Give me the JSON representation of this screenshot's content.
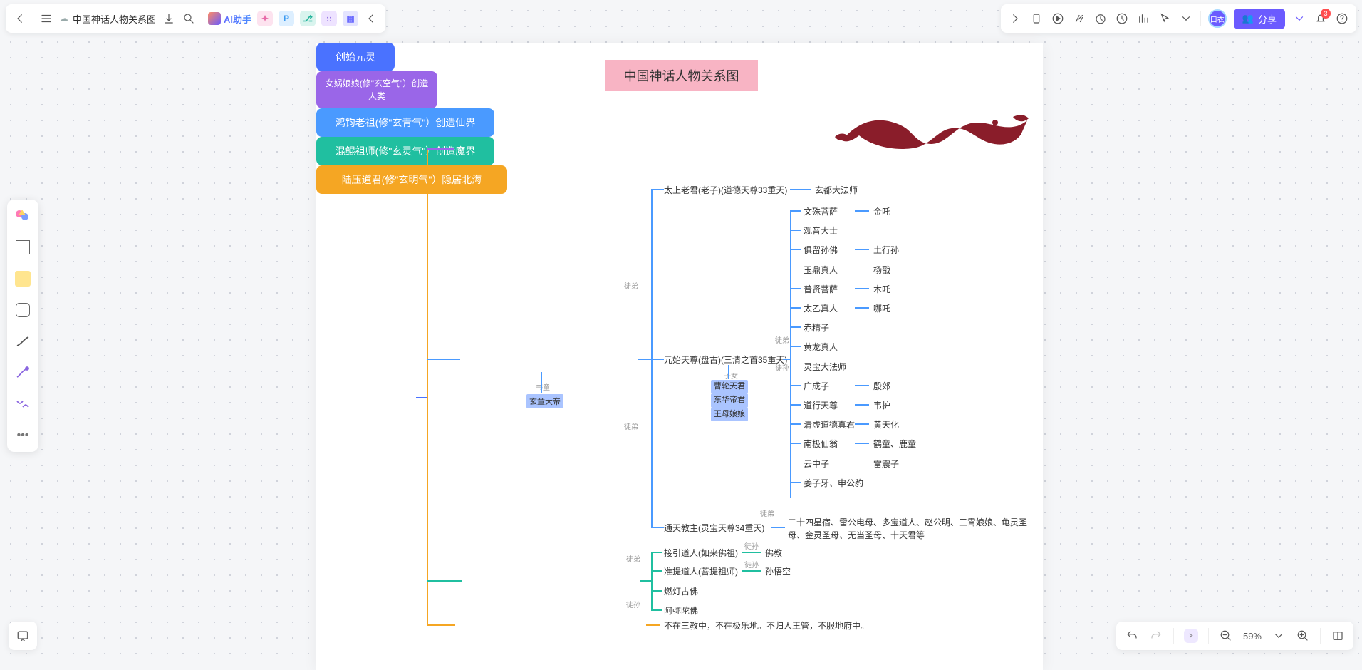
{
  "header": {
    "doc_title": "中国神话人物关系图",
    "ai_label": "AI助手",
    "share_label": "分享",
    "notif_count": "3"
  },
  "canvas": {
    "title": "中国神话人物关系图",
    "root": "创始元灵",
    "branch1": "女娲娘娘(修\"玄空气\"）创造人类",
    "branch2": "鸿钧老祖(修\"玄青气\"）创造仙界",
    "branch2_sub_lbl": "书童",
    "branch2_sub": "玄童大帝",
    "branch3": "混鲲祖师(修\"玄灵气\"）创造魔界",
    "branch4": "陆压道君(修\"玄明气\"）隐居北海",
    "branch4_note": "不在三教中，不在极乐地。不归人王管，不服地府中。",
    "rel_tudi": "徒弟",
    "rel_tusun": "徒孙",
    "rel_zinv": "子女",
    "b2a": "太上老君(老子)(道德天尊33重天)",
    "b2a1": "玄都大法师",
    "b2b": "元始天尊(盘古)(三清之首35重天)",
    "b2c": "通天教主(灵宝天尊34重天)",
    "b2c_list": "二十四星宿、雷公电母、多宝道人、赵公明、三霄娘娘、龟灵圣母、金灵圣母、无当圣母、十天君等",
    "mid1": "曹轮天君",
    "mid2": "东华帝君",
    "mid3": "王母娘娘",
    "disc": [
      {
        "l": "文殊菩萨",
        "r": "金吒"
      },
      {
        "l": "观音大士",
        "r": ""
      },
      {
        "l": "俱留孙佛",
        "r": "土行孙"
      },
      {
        "l": "玉鼎真人",
        "r": "杨戬"
      },
      {
        "l": "普贤菩萨",
        "r": "木吒"
      },
      {
        "l": "太乙真人",
        "r": "哪吒"
      },
      {
        "l": "赤精子",
        "r": ""
      },
      {
        "l": "黄龙真人",
        "r": ""
      },
      {
        "l": "灵宝大法师",
        "r": ""
      },
      {
        "l": "广成子",
        "r": "殷郊"
      },
      {
        "l": "道行天尊",
        "r": "韦护"
      },
      {
        "l": "清虚道德真君",
        "r": "黄天化"
      },
      {
        "l": "南极仙翁",
        "r": "鹤童、鹿童"
      },
      {
        "l": "云中子",
        "r": "雷震子"
      },
      {
        "l": "姜子牙、申公豹",
        "r": ""
      }
    ],
    "b3a": "接引道人(如来佛祖)",
    "b3a_r": "佛教",
    "b3b": "准提道人(菩提祖师)",
    "b3b_r": "孙悟空",
    "b3c": "燃灯古佛",
    "b3d": "阿弥陀佛"
  },
  "footer": {
    "zoom": "59%"
  }
}
